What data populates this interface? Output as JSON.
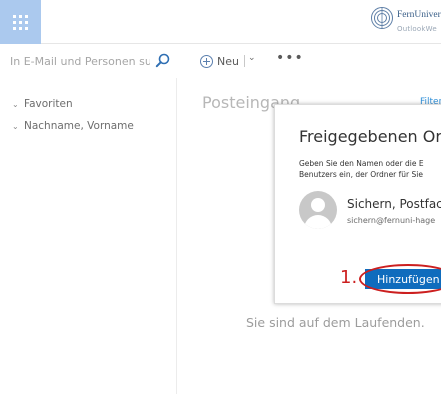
{
  "colors": {
    "waffle_bg": "#abc9ee",
    "accent_blue": "#0f6cbd",
    "link_blue": "#2f8fd8",
    "annotation_red": "#cc1f1f"
  },
  "header": {
    "app_launcher_icon": "waffle-grid-icon",
    "logo_name": "FernUnivers",
    "logo_sub": "OutlookWe"
  },
  "sidebar": {
    "search_placeholder": "In E-Mail und Personen su...",
    "search_icon": "search-icon",
    "items": [
      {
        "label": "Favoriten",
        "icon": "chevron-down-icon"
      },
      {
        "label": "Nachname, Vorname",
        "icon": "chevron-down-icon"
      }
    ]
  },
  "toolbar": {
    "new_label": "Neu",
    "new_icon": "plus-circle-icon",
    "dropdown_icon": "chevron-down-icon",
    "more_label": "•••"
  },
  "main": {
    "folder_title": "Posteingang",
    "filter_label": "Filter",
    "empty_message": "Sie sind auf dem Laufenden."
  },
  "dialog": {
    "title": "Freigegebenen Ord",
    "description_line1": "Geben Sie den Namen oder die E",
    "description_line2": "Benutzers ein, der Ordner für Sie",
    "person_name": "Sichern, Postfach",
    "person_email": "sichern@fernuni-hage",
    "add_button": "Hinzufügen"
  },
  "annotation": {
    "step_label": "1."
  }
}
